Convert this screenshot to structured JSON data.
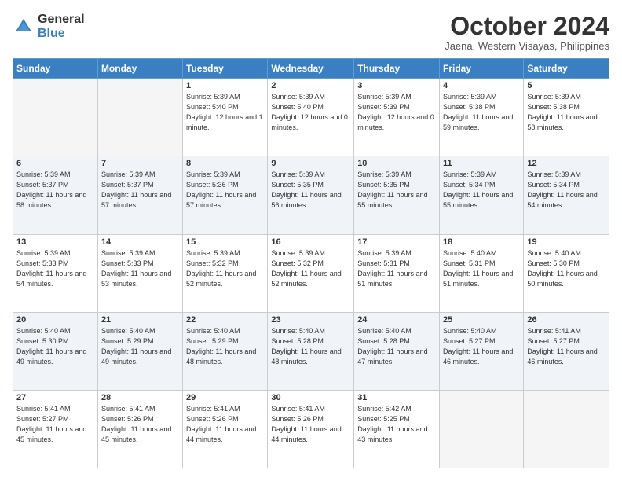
{
  "logo": {
    "general": "General",
    "blue": "Blue"
  },
  "header": {
    "month": "October 2024",
    "location": "Jaena, Western Visayas, Philippines"
  },
  "weekdays": [
    "Sunday",
    "Monday",
    "Tuesday",
    "Wednesday",
    "Thursday",
    "Friday",
    "Saturday"
  ],
  "weeks": [
    [
      {
        "day": "",
        "sunrise": "",
        "sunset": "",
        "daylight": ""
      },
      {
        "day": "",
        "sunrise": "",
        "sunset": "",
        "daylight": ""
      },
      {
        "day": "1",
        "sunrise": "Sunrise: 5:39 AM",
        "sunset": "Sunset: 5:40 PM",
        "daylight": "Daylight: 12 hours and 1 minute."
      },
      {
        "day": "2",
        "sunrise": "Sunrise: 5:39 AM",
        "sunset": "Sunset: 5:40 PM",
        "daylight": "Daylight: 12 hours and 0 minutes."
      },
      {
        "day": "3",
        "sunrise": "Sunrise: 5:39 AM",
        "sunset": "Sunset: 5:39 PM",
        "daylight": "Daylight: 12 hours and 0 minutes."
      },
      {
        "day": "4",
        "sunrise": "Sunrise: 5:39 AM",
        "sunset": "Sunset: 5:38 PM",
        "daylight": "Daylight: 11 hours and 59 minutes."
      },
      {
        "day": "5",
        "sunrise": "Sunrise: 5:39 AM",
        "sunset": "Sunset: 5:38 PM",
        "daylight": "Daylight: 11 hours and 58 minutes."
      }
    ],
    [
      {
        "day": "6",
        "sunrise": "Sunrise: 5:39 AM",
        "sunset": "Sunset: 5:37 PM",
        "daylight": "Daylight: 11 hours and 58 minutes."
      },
      {
        "day": "7",
        "sunrise": "Sunrise: 5:39 AM",
        "sunset": "Sunset: 5:37 PM",
        "daylight": "Daylight: 11 hours and 57 minutes."
      },
      {
        "day": "8",
        "sunrise": "Sunrise: 5:39 AM",
        "sunset": "Sunset: 5:36 PM",
        "daylight": "Daylight: 11 hours and 57 minutes."
      },
      {
        "day": "9",
        "sunrise": "Sunrise: 5:39 AM",
        "sunset": "Sunset: 5:35 PM",
        "daylight": "Daylight: 11 hours and 56 minutes."
      },
      {
        "day": "10",
        "sunrise": "Sunrise: 5:39 AM",
        "sunset": "Sunset: 5:35 PM",
        "daylight": "Daylight: 11 hours and 55 minutes."
      },
      {
        "day": "11",
        "sunrise": "Sunrise: 5:39 AM",
        "sunset": "Sunset: 5:34 PM",
        "daylight": "Daylight: 11 hours and 55 minutes."
      },
      {
        "day": "12",
        "sunrise": "Sunrise: 5:39 AM",
        "sunset": "Sunset: 5:34 PM",
        "daylight": "Daylight: 11 hours and 54 minutes."
      }
    ],
    [
      {
        "day": "13",
        "sunrise": "Sunrise: 5:39 AM",
        "sunset": "Sunset: 5:33 PM",
        "daylight": "Daylight: 11 hours and 54 minutes."
      },
      {
        "day": "14",
        "sunrise": "Sunrise: 5:39 AM",
        "sunset": "Sunset: 5:33 PM",
        "daylight": "Daylight: 11 hours and 53 minutes."
      },
      {
        "day": "15",
        "sunrise": "Sunrise: 5:39 AM",
        "sunset": "Sunset: 5:32 PM",
        "daylight": "Daylight: 11 hours and 52 minutes."
      },
      {
        "day": "16",
        "sunrise": "Sunrise: 5:39 AM",
        "sunset": "Sunset: 5:32 PM",
        "daylight": "Daylight: 11 hours and 52 minutes."
      },
      {
        "day": "17",
        "sunrise": "Sunrise: 5:39 AM",
        "sunset": "Sunset: 5:31 PM",
        "daylight": "Daylight: 11 hours and 51 minutes."
      },
      {
        "day": "18",
        "sunrise": "Sunrise: 5:40 AM",
        "sunset": "Sunset: 5:31 PM",
        "daylight": "Daylight: 11 hours and 51 minutes."
      },
      {
        "day": "19",
        "sunrise": "Sunrise: 5:40 AM",
        "sunset": "Sunset: 5:30 PM",
        "daylight": "Daylight: 11 hours and 50 minutes."
      }
    ],
    [
      {
        "day": "20",
        "sunrise": "Sunrise: 5:40 AM",
        "sunset": "Sunset: 5:30 PM",
        "daylight": "Daylight: 11 hours and 49 minutes."
      },
      {
        "day": "21",
        "sunrise": "Sunrise: 5:40 AM",
        "sunset": "Sunset: 5:29 PM",
        "daylight": "Daylight: 11 hours and 49 minutes."
      },
      {
        "day": "22",
        "sunrise": "Sunrise: 5:40 AM",
        "sunset": "Sunset: 5:29 PM",
        "daylight": "Daylight: 11 hours and 48 minutes."
      },
      {
        "day": "23",
        "sunrise": "Sunrise: 5:40 AM",
        "sunset": "Sunset: 5:28 PM",
        "daylight": "Daylight: 11 hours and 48 minutes."
      },
      {
        "day": "24",
        "sunrise": "Sunrise: 5:40 AM",
        "sunset": "Sunset: 5:28 PM",
        "daylight": "Daylight: 11 hours and 47 minutes."
      },
      {
        "day": "25",
        "sunrise": "Sunrise: 5:40 AM",
        "sunset": "Sunset: 5:27 PM",
        "daylight": "Daylight: 11 hours and 46 minutes."
      },
      {
        "day": "26",
        "sunrise": "Sunrise: 5:41 AM",
        "sunset": "Sunset: 5:27 PM",
        "daylight": "Daylight: 11 hours and 46 minutes."
      }
    ],
    [
      {
        "day": "27",
        "sunrise": "Sunrise: 5:41 AM",
        "sunset": "Sunset: 5:27 PM",
        "daylight": "Daylight: 11 hours and 45 minutes."
      },
      {
        "day": "28",
        "sunrise": "Sunrise: 5:41 AM",
        "sunset": "Sunset: 5:26 PM",
        "daylight": "Daylight: 11 hours and 45 minutes."
      },
      {
        "day": "29",
        "sunrise": "Sunrise: 5:41 AM",
        "sunset": "Sunset: 5:26 PM",
        "daylight": "Daylight: 11 hours and 44 minutes."
      },
      {
        "day": "30",
        "sunrise": "Sunrise: 5:41 AM",
        "sunset": "Sunset: 5:26 PM",
        "daylight": "Daylight: 11 hours and 44 minutes."
      },
      {
        "day": "31",
        "sunrise": "Sunrise: 5:42 AM",
        "sunset": "Sunset: 5:25 PM",
        "daylight": "Daylight: 11 hours and 43 minutes."
      },
      {
        "day": "",
        "sunrise": "",
        "sunset": "",
        "daylight": ""
      },
      {
        "day": "",
        "sunrise": "",
        "sunset": "",
        "daylight": ""
      }
    ]
  ]
}
